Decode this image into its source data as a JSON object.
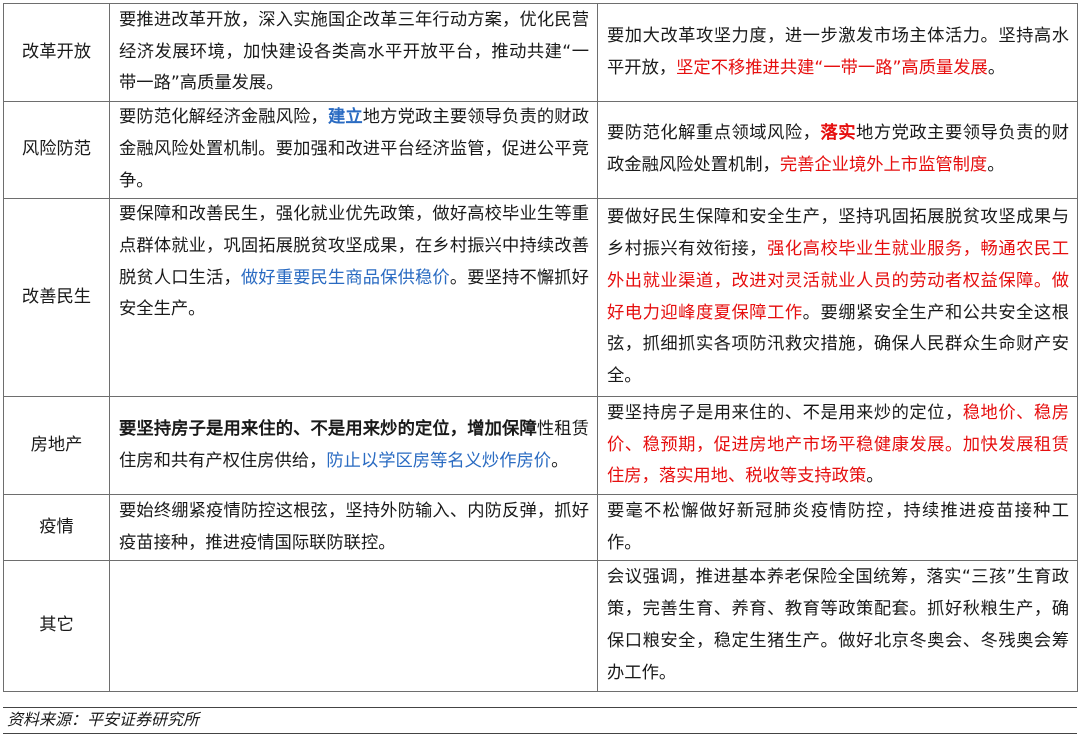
{
  "rows": [
    {
      "label": "改革开放",
      "left": [
        {
          "t": "要推进改革开放，深入实施国企改革三年行动方案，优化民营经济发展环境，加快建设各类高水平开放平台，推动共建“一带一路”高质量发展。",
          "c": ""
        }
      ],
      "right": [
        {
          "t": "要加大改革攻坚力度，进一步激发市场主体活力。坚持高水平开放，",
          "c": ""
        },
        {
          "t": "坚定不移推进共建“一带一路”高质量发展",
          "c": "red"
        },
        {
          "t": "。",
          "c": ""
        }
      ]
    },
    {
      "label": "风险防范",
      "left": [
        {
          "t": "要防范化解经济金融风险，",
          "c": ""
        },
        {
          "t": "建立",
          "c": "blue bold"
        },
        {
          "t": "地方党政主要领导负责的财政金融风险处置机制。要加强和改进平台经济监管，促进公平竞争。",
          "c": ""
        }
      ],
      "right": [
        {
          "t": "要防范化解重点领域风险，",
          "c": ""
        },
        {
          "t": "落实",
          "c": "red bold"
        },
        {
          "t": "地方党政主要领导负责的财政金融风险处置机制，",
          "c": ""
        },
        {
          "t": "完善企业境外上市监管制度",
          "c": "red"
        },
        {
          "t": "。",
          "c": ""
        }
      ]
    },
    {
      "label": "改善民生",
      "left": [
        {
          "t": "要保障和改善民生，强化就业优先政策，做好高校毕业生等重点群体就业，巩固拓展脱贫攻坚成果，在乡村振兴中持续改善脱贫人口生活，",
          "c": ""
        },
        {
          "t": "做好重要民生商品保供稳价",
          "c": "blue"
        },
        {
          "t": "。要坚持不懈抓好安全生产。",
          "c": ""
        }
      ],
      "right": [
        {
          "t": "要做好民生保障和安全生产，坚持巩固拓展脱贫攻坚成果与乡村振兴有效衔接，",
          "c": ""
        },
        {
          "t": "强化高校毕业生就业服务，畅通农民工外出就业渠道",
          "c": "red"
        },
        {
          "t": "，改进对灵活就业人员的劳动者权益保障。",
          "c": "red"
        },
        {
          "t": "做好电力迎峰度夏保障工作",
          "c": "red"
        },
        {
          "t": "。要绷紧安全生产和公共安全这根弦，抓细抓实各项防汛救灾措施，确保人民群众生命财产安全。",
          "c": ""
        }
      ]
    },
    {
      "label": "房地产",
      "left": [
        {
          "t": "要坚持房子是用来住的、不是用来炒的定位，增加保障",
          "c": "bold"
        },
        {
          "t": "性租赁住房和共有产权住房供给，",
          "c": ""
        },
        {
          "t": "防止以学区房等名义炒作房价",
          "c": "blue"
        },
        {
          "t": "。",
          "c": ""
        }
      ],
      "right": [
        {
          "t": "要坚持房子是用来住的、不是用来炒的定位，",
          "c": ""
        },
        {
          "t": "稳地价、稳房价、稳预期，促进房地产市场平稳健康发展。",
          "c": "red"
        },
        {
          "t": "加快发展租赁住房，落实用地、税收等支持政策",
          "c": "red"
        },
        {
          "t": "。",
          "c": ""
        }
      ]
    },
    {
      "label": "疫情",
      "left": [
        {
          "t": "要始终绷紧疫情防控这根弦，坚持外防输入、内防反弹，抓好疫苗接种，推进疫情国际联防联控。",
          "c": ""
        }
      ],
      "right": [
        {
          "t": "要毫不松懈做好新冠肺炎疫情防控，持续推进疫苗接种工作。",
          "c": ""
        }
      ]
    },
    {
      "label": "其它",
      "left": [],
      "right": [
        {
          "t": "会议强调，推进基本养老保险全国统筹，落实“三孩”生育政策，完善生育、养育、教育等政策配套。抓好秋粮生产，确保口粮安全，稳定生猪生产。做好北京冬奥会、冬残奥会筹办工作。",
          "c": ""
        }
      ]
    }
  ],
  "source": "资料来源：平安证券研究所"
}
